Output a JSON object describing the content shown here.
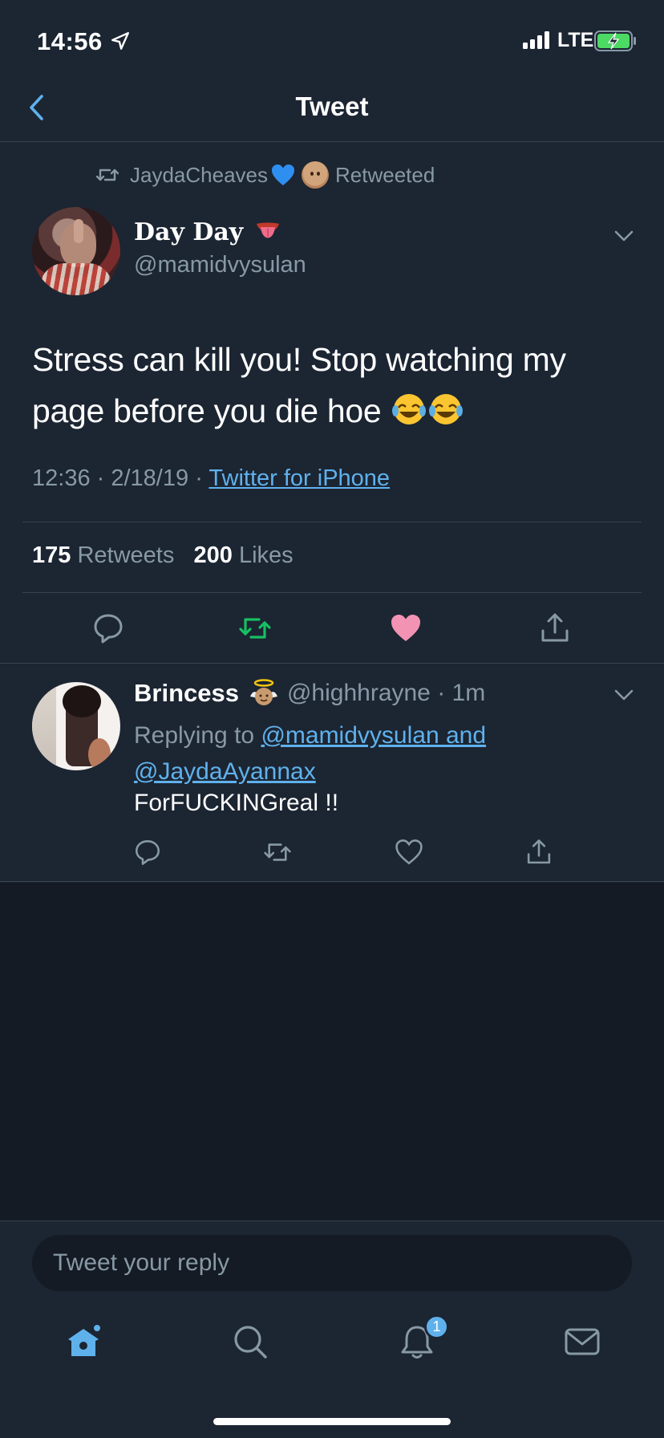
{
  "status_bar": {
    "time": "14:56",
    "network": "LTE"
  },
  "header": {
    "title": "Tweet"
  },
  "retweet_banner": {
    "user": "JaydaCheaves",
    "label": "Retweeted"
  },
  "tweet": {
    "display_name": "Day Day",
    "handle": "@mamidvysulan",
    "text": "Stress can kill you! Stop watching my page before you die hoe",
    "time": "12:36",
    "date": "2/18/19",
    "source": "Twitter for iPhone",
    "retweets": "175",
    "retweets_label": "Retweets",
    "likes": "200",
    "likes_label": "Likes",
    "liked": true,
    "retweeted": true
  },
  "reply": {
    "display_name": "Brincess",
    "handle": "@highhrayne",
    "age": "1m",
    "replying_prefix": "Replying to",
    "replying_to_1": "@mamidvysulan and",
    "replying_to_2": "@JaydaAyannax",
    "text": "ForFUCKINGreal !!"
  },
  "composer": {
    "placeholder": "Tweet your reply"
  },
  "tab_bar": {
    "items": [
      "home-icon",
      "search-icon",
      "notifications-icon",
      "messages-icon"
    ],
    "active": "home",
    "notification_count": "1"
  },
  "colors": {
    "background": "#1c2532",
    "secondary_text": "#8899a6",
    "link": "#5fb1ec",
    "retweet_green": "#17bf63",
    "like_pink": "#e0245e"
  }
}
